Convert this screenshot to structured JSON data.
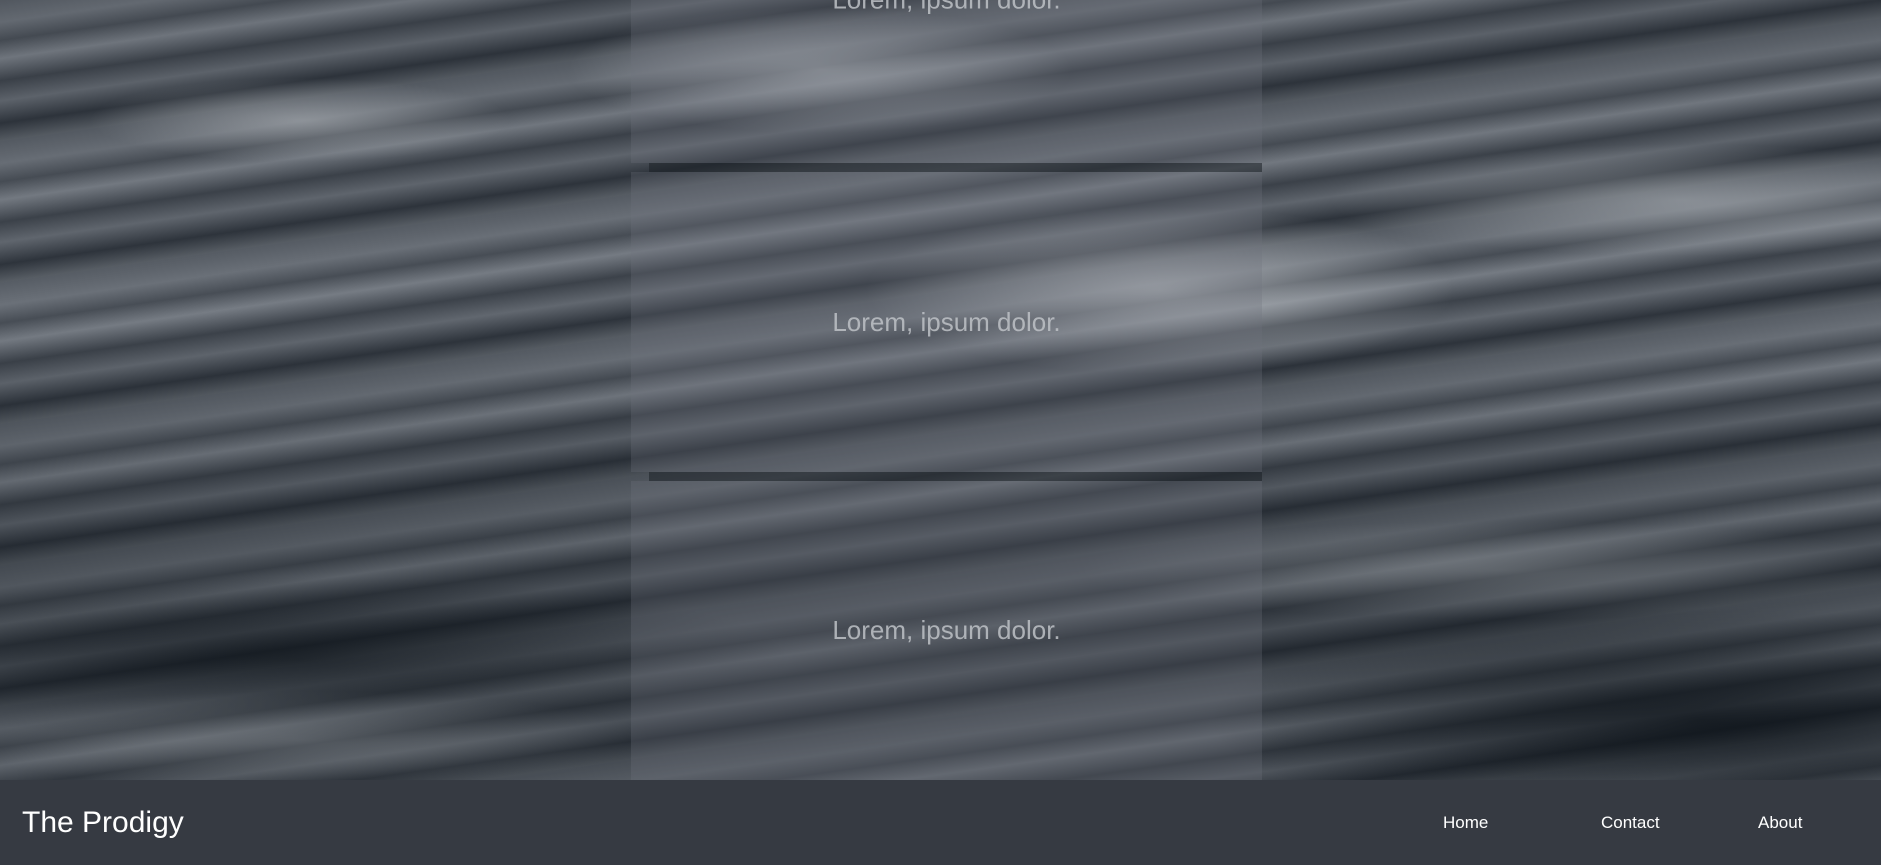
{
  "panels": [
    {
      "text": "Lorem, ipsum dolor."
    },
    {
      "text": "Lorem, ipsum dolor."
    },
    {
      "text": "Lorem, ipsum dolor."
    }
  ],
  "navbar": {
    "brand": "The Prodigy",
    "links": [
      {
        "label": "Home"
      },
      {
        "label": "Contact"
      },
      {
        "label": "About"
      }
    ]
  },
  "colors": {
    "navbar_bg": "#363a42",
    "nav_text": "#ffffff"
  }
}
